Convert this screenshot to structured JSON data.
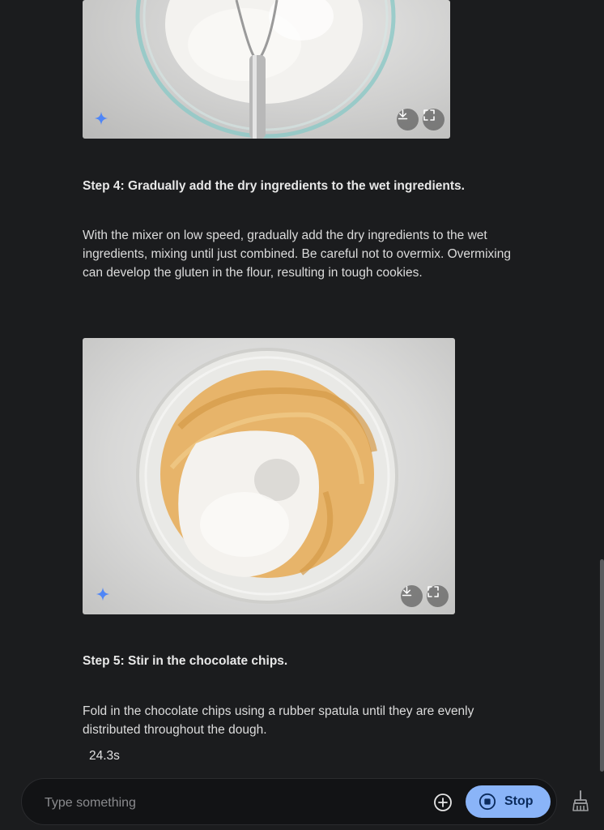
{
  "images": [
    {
      "alt_icon": "sparkle-icon",
      "download_icon": "download-icon",
      "fullscreen_icon": "fullscreen-icon"
    },
    {
      "alt_icon": "sparkle-icon",
      "download_icon": "download-icon",
      "fullscreen_icon": "fullscreen-icon"
    }
  ],
  "steps": [
    {
      "heading": "Step 4: Gradually add the dry ingredients to the wet ingredients.",
      "body": "With the mixer on low speed, gradually add the dry ingredients to the wet ingredients, mixing until just combined. Be careful not to overmix. Overmixing can develop the gluten in the flour, resulting in tough cookies."
    },
    {
      "heading": "Step 5: Stir in the chocolate chips.",
      "body": "Fold in the chocolate chips using a rubber spatula until they are evenly distributed throughout the dough."
    }
  ],
  "timer": "24.3s",
  "composer": {
    "placeholder": "Type something",
    "add_icon": "plus-circle-icon",
    "stop_label": "Stop",
    "stop_icon": "stop-icon",
    "broom_icon": "broom-icon"
  },
  "colors": {
    "background": "#1b1c1e",
    "accent": "#8ab4f8",
    "sparkle": "#4f86f7"
  }
}
